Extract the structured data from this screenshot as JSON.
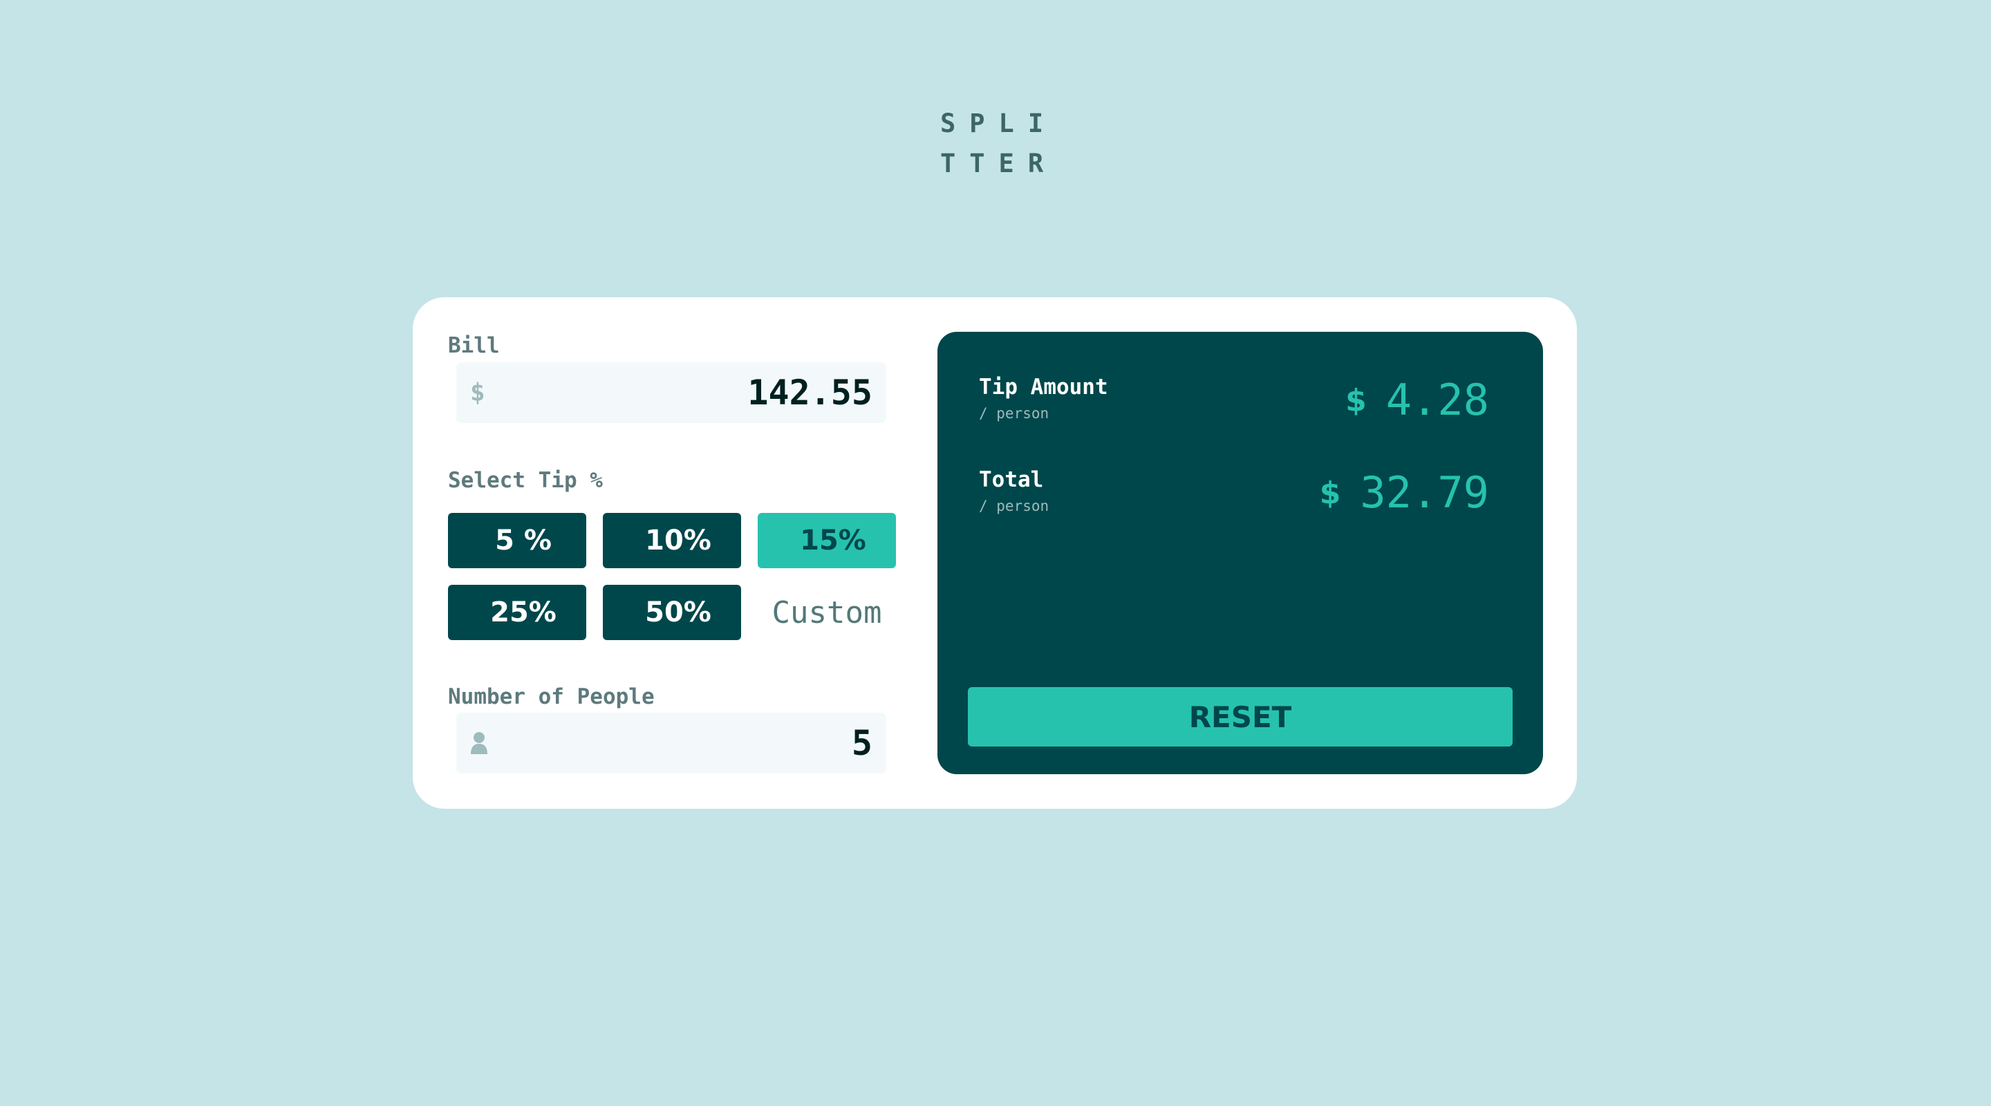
{
  "logo": {
    "line1": "SPLI",
    "line2": "TTER"
  },
  "bill": {
    "label": "Bill",
    "currency_symbol": "$",
    "value": "142.55"
  },
  "tip": {
    "label": "Select Tip %",
    "options": [
      "5 %",
      "10%",
      "15%",
      "25%",
      "50%"
    ],
    "selected": "15%",
    "custom_placeholder": "Custom"
  },
  "people": {
    "label": "Number of People",
    "icon": "person-icon",
    "value": "5"
  },
  "results": {
    "tip_label": "Tip Amount",
    "tip_sub": "/ person",
    "tip_currency": "$",
    "tip_value": "4.28",
    "total_label": "Total",
    "total_sub": "/ person",
    "total_currency": "$",
    "total_value": "32.79",
    "reset_label": "RESET"
  },
  "colors": {
    "background": "#c5e4e7",
    "dark_teal": "#00474b",
    "accent": "#26c2ae",
    "card": "#ffffff"
  }
}
